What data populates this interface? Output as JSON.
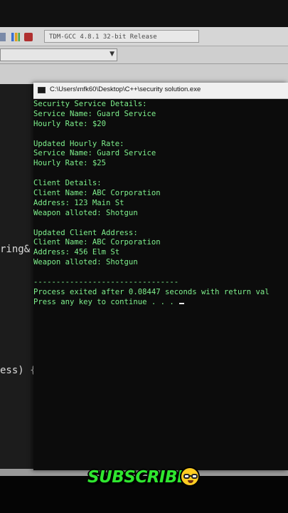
{
  "ide": {
    "compiler_label": "TDM-GCC 4.8.1 32-bit Release",
    "editor_fragments": {
      "string_ref": "ring&",
      "method_sig": "ess) {"
    }
  },
  "console": {
    "title": "C:\\Users\\mfk60\\Desktop\\C++\\security solution.exe",
    "lines": [
      "Security Service Details:",
      "Service Name: Guard Service",
      "Hourly Rate: $20",
      "",
      "Updated Hourly Rate:",
      "Service Name: Guard Service",
      "Hourly Rate: $25",
      "",
      "Client Details:",
      "Client Name: ABC Corporation",
      "Address: 123 Main St",
      "Weapon alloted: Shotgun",
      "",
      "Updated Client Address:",
      "Client Name: ABC Corporation",
      "Address: 456 Elm St",
      "Weapon alloted: Shotgun",
      "",
      "--------------------------------",
      "Process exited after 0.08447 seconds with return val",
      "Press any key to continue . . . "
    ]
  },
  "overlay": {
    "subscribe_text": "SUBSCRIBE"
  },
  "colors": {
    "console_text": "#7ef08c",
    "subscribe": "#2fe62f"
  }
}
